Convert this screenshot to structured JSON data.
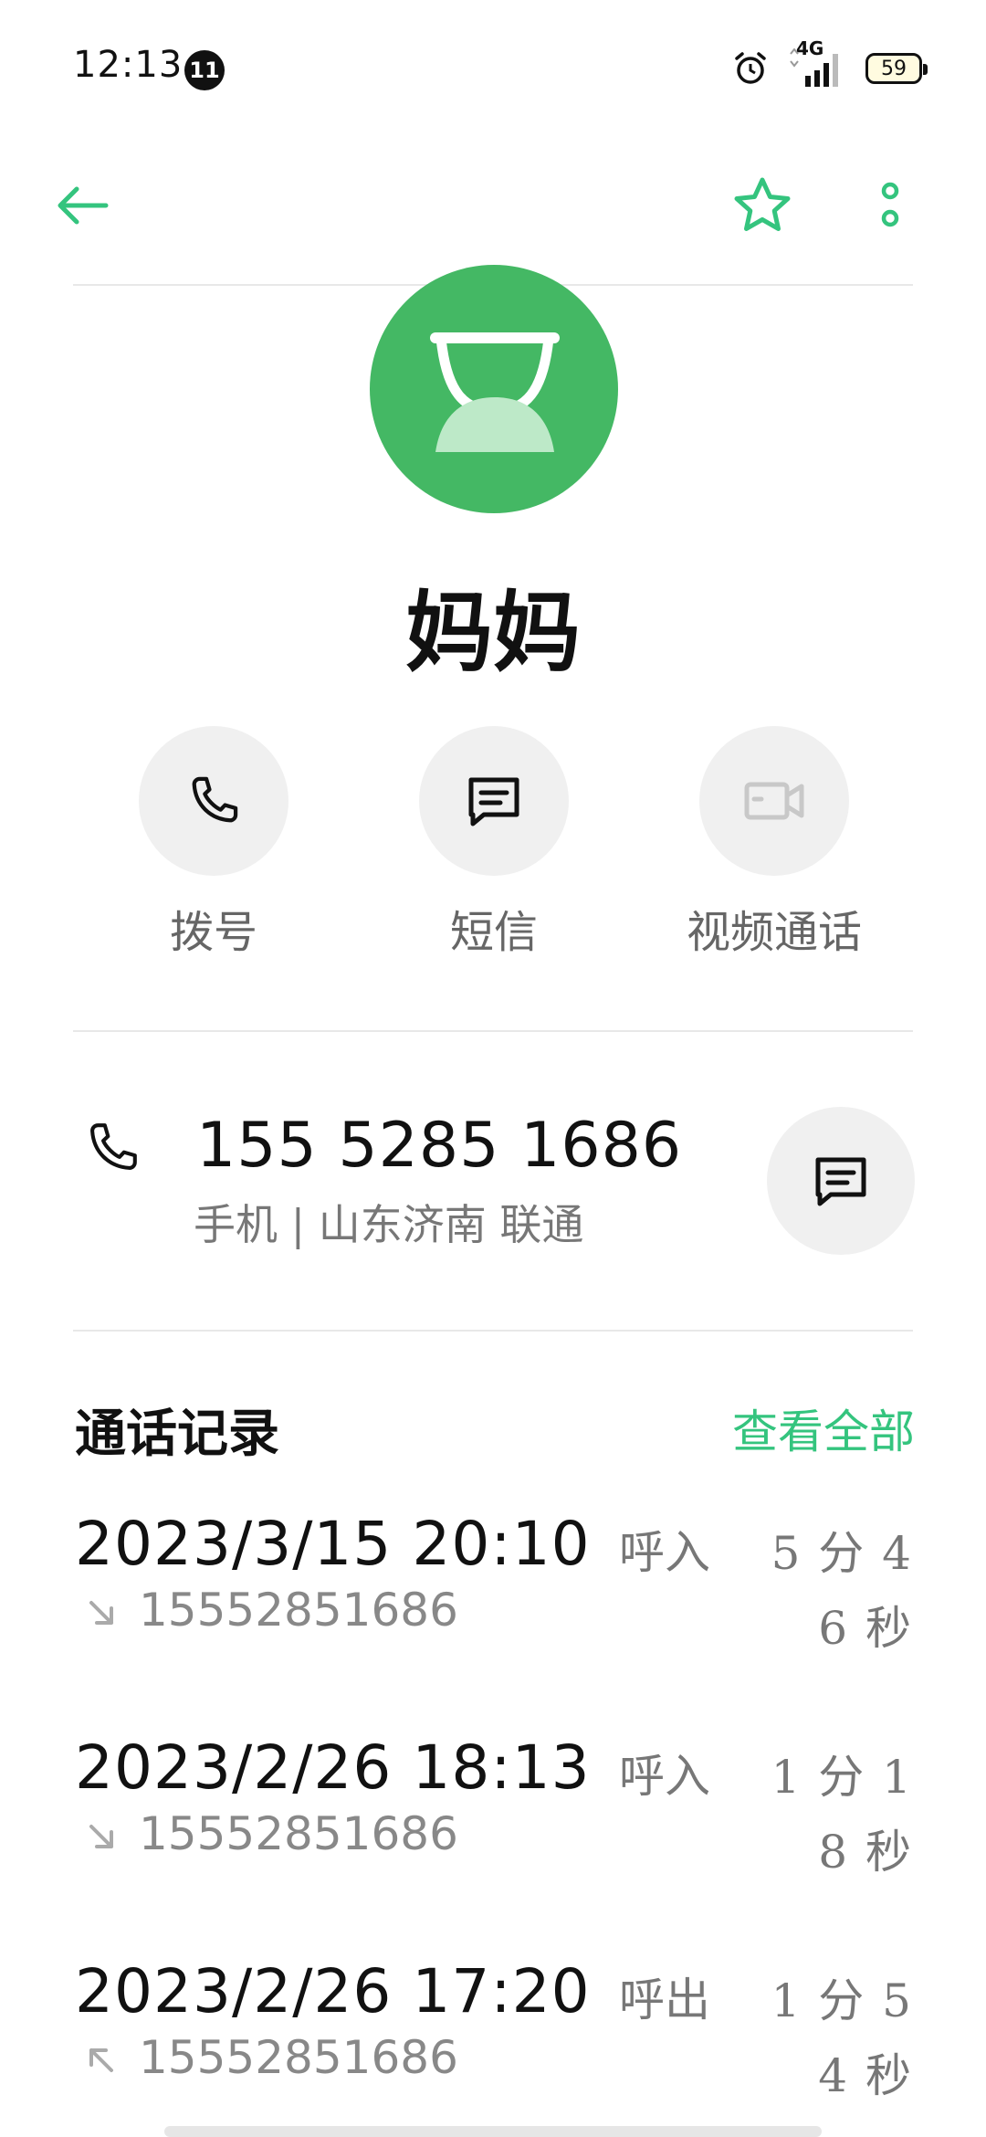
{
  "status_bar": {
    "time": "12:13",
    "notification_count": "11",
    "network": "4G",
    "battery": "59"
  },
  "colors": {
    "accent": "#34c47e",
    "avatar_bg": "#44b864"
  },
  "icons": {
    "back": "arrow-left-icon",
    "favorite": "star-outline-icon",
    "more": "more-vertical-icon",
    "call": "phone-icon",
    "message": "message-icon",
    "video": "video-camera-icon"
  },
  "contact": {
    "name": "妈妈"
  },
  "actions": {
    "call_label": "拨号",
    "sms_label": "短信",
    "video_label": "视频通话"
  },
  "phone": {
    "number": "155 5285 1686",
    "meta": "手机 | 山东济南 联通"
  },
  "history": {
    "title": "通话记录",
    "view_all": "查看全部",
    "records": [
      {
        "datetime": "2023/3/15 20:10",
        "number": "15552851686",
        "type": "呼入",
        "direction": "incoming",
        "duration": "5 分 46 秒"
      },
      {
        "datetime": "2023/2/26 18:13",
        "number": "15552851686",
        "type": "呼入",
        "direction": "incoming",
        "duration": "1 分 18 秒"
      },
      {
        "datetime": "2023/2/26 17:20",
        "number": "15552851686",
        "type": "呼出",
        "direction": "outgoing",
        "duration": "1 分 54 秒"
      }
    ]
  }
}
